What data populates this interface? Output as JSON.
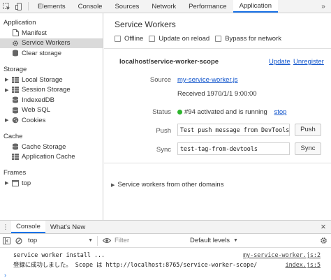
{
  "toolbar": {
    "tabs": [
      "Elements",
      "Console",
      "Sources",
      "Network",
      "Performance",
      "Application"
    ],
    "active_tab": "Application",
    "more_glyph": "»"
  },
  "sidebar": {
    "application": {
      "title": "Application",
      "items": [
        {
          "label": "Manifest",
          "icon": "document-icon"
        },
        {
          "label": "Service Workers",
          "icon": "gear-icon",
          "selected": true
        },
        {
          "label": "Clear storage",
          "icon": "storage-icon"
        }
      ]
    },
    "storage": {
      "title": "Storage",
      "items": [
        {
          "label": "Local Storage",
          "icon": "grid-icon",
          "expandable": true
        },
        {
          "label": "Session Storage",
          "icon": "grid-icon",
          "expandable": true
        },
        {
          "label": "IndexedDB",
          "icon": "database-icon"
        },
        {
          "label": "Web SQL",
          "icon": "database-icon"
        },
        {
          "label": "Cookies",
          "icon": "cookie-icon",
          "expandable": true
        }
      ]
    },
    "cache": {
      "title": "Cache",
      "items": [
        {
          "label": "Cache Storage",
          "icon": "database-icon"
        },
        {
          "label": "Application Cache",
          "icon": "grid-icon"
        }
      ]
    },
    "frames": {
      "title": "Frames",
      "items": [
        {
          "label": "top",
          "icon": "frame-icon",
          "expandable": true
        }
      ]
    }
  },
  "main": {
    "title": "Service Workers",
    "options": [
      {
        "label": "Offline",
        "checked": false
      },
      {
        "label": "Update on reload",
        "checked": false
      },
      {
        "label": "Bypass for network",
        "checked": false
      }
    ],
    "scope": "localhost/service-worker-scope",
    "update_label": "Update",
    "unregister_label": "Unregister",
    "source_label": "Source",
    "source_link": "my-service-worker.js",
    "received": "Received 1970/1/1 9:00:00",
    "status_label": "Status",
    "status_text": "#94 activated and is running",
    "status_color": "#2db52d",
    "stop_label": "stop",
    "push_label": "Push",
    "push_value": "Test push message from DevTools.",
    "push_button": "Push",
    "sync_label": "Sync",
    "sync_value": "test-tag-from-devtools",
    "sync_button": "Sync",
    "other_domains": "Service workers from other domains"
  },
  "drawer": {
    "tabs": [
      "Console",
      "What's New"
    ],
    "active_tab": "Console",
    "context": "top",
    "filter_placeholder": "Filter",
    "levels": "Default levels",
    "logs": [
      {
        "message": "service worker install ...",
        "source": "my-service-worker.js:2"
      },
      {
        "message": "登録に成功しました。 Scope は http://localhost:8765/service-worker-scope/",
        "source": "index.js:5"
      }
    ],
    "prompt": "›"
  },
  "colors": {
    "accent": "#1a73e8",
    "link": "#1155cc",
    "selected_bg": "#dadada"
  }
}
